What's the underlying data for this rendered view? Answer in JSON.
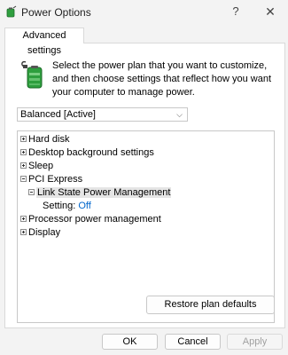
{
  "window": {
    "title": "Power Options",
    "help_glyph": "?",
    "close_glyph": "✕"
  },
  "tab": {
    "label": "Advanced settings"
  },
  "intro": {
    "text": "Select the power plan that you want to customize, and then choose settings that reflect how you want your computer to manage power."
  },
  "plan_select": {
    "value": "Balanced [Active]",
    "chevron": "⌵"
  },
  "tree": {
    "items": [
      {
        "label": "Hard disk",
        "expander": "plus"
      },
      {
        "label": "Desktop background settings",
        "expander": "plus"
      },
      {
        "label": "Sleep",
        "expander": "plus"
      },
      {
        "label": "PCI Express",
        "expander": "minus"
      },
      {
        "label": "Link State Power Management",
        "expander": "minus"
      },
      {
        "label": "Setting:",
        "value": "Off"
      },
      {
        "label": "Processor power management",
        "expander": "plus"
      },
      {
        "label": "Display",
        "expander": "plus"
      }
    ]
  },
  "buttons": {
    "restore": "Restore plan defaults",
    "ok": "OK",
    "cancel": "Cancel",
    "apply": "Apply"
  },
  "colors": {
    "accent_link": "#0066cc",
    "selection": "#e5e5e5",
    "battery_green": "#2e9e3e"
  },
  "icons": {
    "app": "power-options-icon",
    "header": "battery-plug-icon"
  }
}
